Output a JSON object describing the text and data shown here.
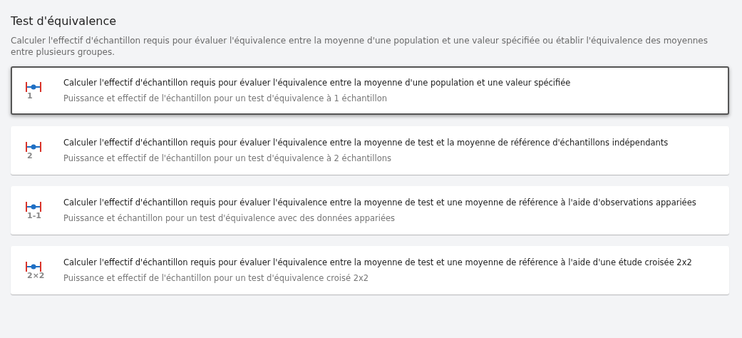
{
  "title": "Test d'équivalence",
  "description": "Calculer l'effectif d'échantillon requis pour évaluer l'équivalence entre la moyenne d'une population et une valeur spécifiée ou établir l'équivalence des moyennes entre plusieurs groupes.",
  "options": [
    {
      "icon_label": "1",
      "title": "Calculer l'effectif d'échantillon requis pour évaluer l'équivalence entre la moyenne d'une population et une valeur spécifiée",
      "subtitle": "Puissance et effectif de l'échantillon pour un test d'équivalence à 1 échantillon",
      "selected": true
    },
    {
      "icon_label": "2",
      "title": "Calculer l'effectif d'échantillon requis pour évaluer l'équivalence entre la moyenne de test et la moyenne de référence d'échantillons indépendants",
      "subtitle": "Puissance et effectif de l'échantillon pour un test d'équivalence à 2 échantillons",
      "selected": false
    },
    {
      "icon_label": "1-1",
      "title": "Calculer l'effectif d'échantillon requis pour évaluer l'équivalence entre la moyenne de test et une moyenne de référence à l'aide d'observations appariées",
      "subtitle": "Puissance et échantillon pour un test d'équivalence avec des données appariées",
      "selected": false
    },
    {
      "icon_label": "2×2",
      "title": "Calculer l'effectif d'échantillon requis pour évaluer l'équivalence entre la moyenne de test et une moyenne de référence à l'aide d'une étude croisée 2x2",
      "subtitle": "Puissance et effectif de l'échantillon pour un test d'équivalence croisé 2x2",
      "selected": false
    }
  ]
}
